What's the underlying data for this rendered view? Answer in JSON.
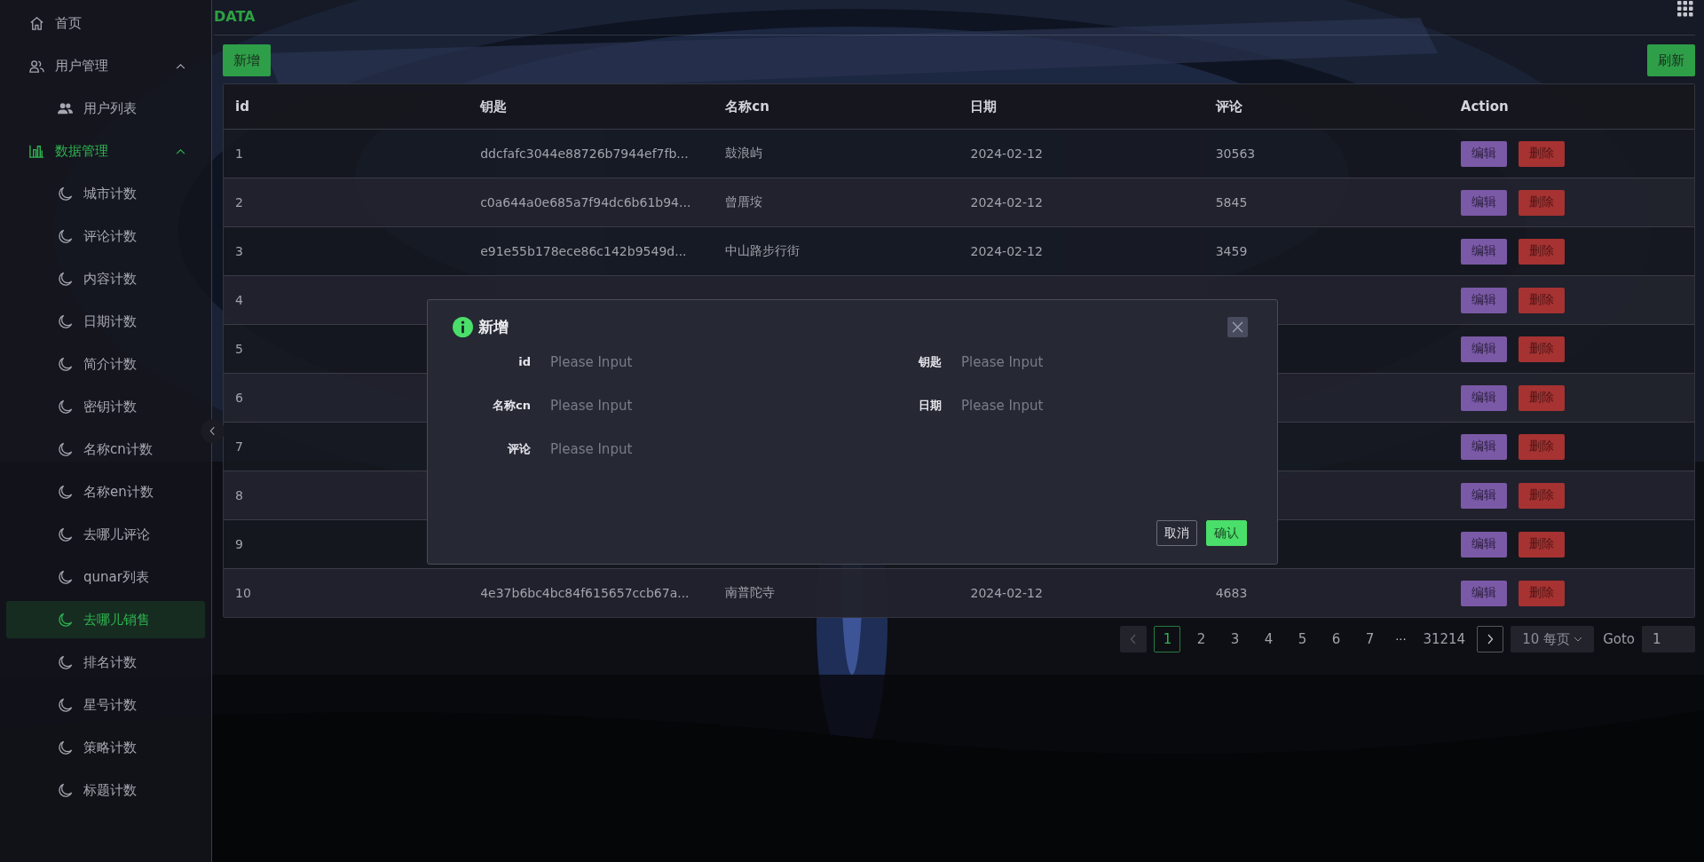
{
  "header": {
    "title": "DATA"
  },
  "sidebar": {
    "items": [
      {
        "label": "首页",
        "selected": false
      },
      {
        "label": "用户管理",
        "selected": false,
        "expanded": true,
        "children": [
          {
            "label": "用户列表",
            "selected": false
          }
        ]
      },
      {
        "label": "数据管理",
        "selected": false,
        "expanded": true,
        "children": [
          {
            "label": "城市计数",
            "selected": false
          },
          {
            "label": "评论计数",
            "selected": false
          },
          {
            "label": "内容计数",
            "selected": false
          },
          {
            "label": "日期计数",
            "selected": false
          },
          {
            "label": "简介计数",
            "selected": false
          },
          {
            "label": "密钥计数",
            "selected": false
          },
          {
            "label": "名称cn计数",
            "selected": false
          },
          {
            "label": "名称en计数",
            "selected": false
          },
          {
            "label": "去哪儿评论",
            "selected": false
          },
          {
            "label": "qunar列表",
            "selected": false
          },
          {
            "label": "去哪儿销售",
            "selected": true
          },
          {
            "label": "排名计数",
            "selected": false
          },
          {
            "label": "星号计数",
            "selected": false
          },
          {
            "label": "策略计数",
            "selected": false
          },
          {
            "label": "标题计数",
            "selected": false
          }
        ]
      }
    ]
  },
  "toolbar": {
    "add_button": "新增",
    "refresh_button": "刷新"
  },
  "table": {
    "columns": [
      "id",
      "钥匙",
      "名称cn",
      "日期",
      "评论",
      "Action"
    ],
    "rows": [
      {
        "id": "1",
        "key": "ddcfafc3044e88726b7944ef7fb...",
        "name_cn": "鼓浪屿",
        "date": "2024-02-12",
        "comment": "30563",
        "actions": [
          "编辑",
          "删除"
        ]
      },
      {
        "id": "2",
        "key": "c0a644a0e685a7f94dc6b61b94...",
        "name_cn": "曾厝垵",
        "date": "2024-02-12",
        "comment": "5845",
        "actions": [
          "编辑",
          "删除"
        ]
      },
      {
        "id": "3",
        "key": "e91e55b178ece86c142b9549d...",
        "name_cn": "中山路步行街",
        "date": "2024-02-12",
        "comment": "3459",
        "actions": [
          "编辑",
          "删除"
        ]
      },
      {
        "id": "4",
        "actions": [
          "编辑",
          "删除"
        ]
      },
      {
        "id": "5",
        "actions": [
          "编辑",
          "删除"
        ]
      },
      {
        "id": "6",
        "actions": [
          "编辑",
          "删除"
        ]
      },
      {
        "id": "7",
        "actions": [
          "编辑",
          "删除"
        ]
      },
      {
        "id": "8",
        "actions": [
          "编辑",
          "删除"
        ]
      },
      {
        "id": "9",
        "actions": [
          "编辑",
          "删除"
        ]
      },
      {
        "id": "10",
        "key": "4e37b6bc4bc84f615657ccb67a...",
        "name_cn": "南普陀寺",
        "date": "2024-02-12",
        "comment": "4683",
        "actions": [
          "编辑",
          "删除"
        ]
      }
    ]
  },
  "pagination": {
    "prev": {
      "disabled": true
    },
    "next": {
      "disabled": false
    },
    "pages": [
      {
        "kind": "page",
        "label": "1",
        "selected": true
      },
      {
        "kind": "page",
        "label": "2",
        "selected": false
      },
      {
        "kind": "page",
        "label": "3",
        "selected": false
      },
      {
        "kind": "page",
        "label": "4",
        "selected": false
      },
      {
        "kind": "page",
        "label": "5",
        "selected": false
      },
      {
        "kind": "page",
        "label": "6",
        "selected": false
      },
      {
        "kind": "page",
        "label": "7",
        "selected": false
      },
      {
        "kind": "ellipsis",
        "label": "···",
        "selected": false
      },
      {
        "kind": "page",
        "label": "31214",
        "selected": false
      }
    ],
    "page_size": "10 每页",
    "goto_label": "Goto",
    "goto_value": "1"
  },
  "dialog": {
    "title": "新增",
    "fields": [
      {
        "label": "id",
        "placeholder": "Please Input"
      },
      {
        "label": "钥匙",
        "placeholder": "Please Input"
      },
      {
        "label": "名称cn",
        "placeholder": "Please Input"
      },
      {
        "label": "日期",
        "placeholder": "Please Input"
      },
      {
        "label": "评论",
        "placeholder": "Please Input"
      }
    ],
    "buttons": [
      {
        "kind": "secondary",
        "label": "取消"
      },
      {
        "kind": "primary",
        "label": "确认"
      }
    ]
  }
}
